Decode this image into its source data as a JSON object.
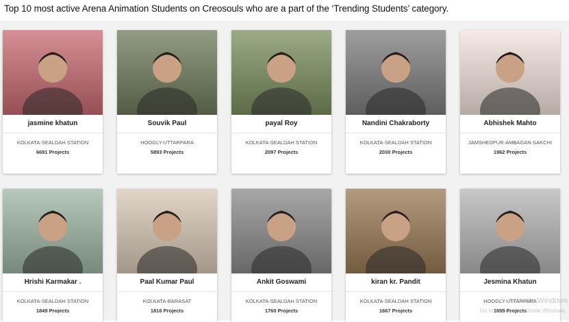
{
  "caption": "Top 10 most active Arena Animation Students on Creosouls who are a part of the ‘Trending Students’ category.",
  "students": [
    {
      "name": "jasmine khatun",
      "location": "KOLKATA-SEALDAH STATION",
      "projects": "6691 Projects",
      "bg": "#c76a72"
    },
    {
      "name": "Souvik Paul",
      "location": "HOOGLY-UTTARPARA",
      "projects": "5893 Projects",
      "bg": "#6f7a5a"
    },
    {
      "name": "payal Roy",
      "location": "KOLKATA-SEALDAH STATION",
      "projects": "2097 Projects",
      "bg": "#7a8f5e"
    },
    {
      "name": "Nandini Chakraborty",
      "location": "KOLKATA-SEALDAH STATION",
      "projects": "2030 Projects",
      "bg": "#7d7d7d"
    },
    {
      "name": "Abhishek Mahto",
      "location": "JAMSHEDPUR-AMBAGAN-SAKCHI",
      "projects": "1962 Projects",
      "bg": "#f3e3dc"
    },
    {
      "name": "Hrishi Karmakar .",
      "location": "KOLKATA-SEALDAH STATION",
      "projects": "1849 Projects",
      "bg": "#9fb7a4"
    },
    {
      "name": "Paal Kumar Paul",
      "location": "KOLKATA-BARASAT",
      "projects": "1816 Projects",
      "bg": "#d9c9b8"
    },
    {
      "name": "Ankit Goswami",
      "location": "KOLKATA-SEALDAH STATION",
      "projects": "1760 Projects",
      "bg": "#8a8a8a"
    },
    {
      "name": "kiran kr. Pandit",
      "location": "KOLKATA-SEALDAH STATION",
      "projects": "1667 Projects",
      "bg": "#9a7a55"
    },
    {
      "name": "Jesmina Khatun",
      "location": "HOOGLY-UTTARPARA",
      "projects": "1655 Projects",
      "bg": "#b5b5b5"
    }
  ],
  "watermark": {
    "line1": "Activate Windows",
    "line2": "Go to Settings to activate Windows."
  }
}
